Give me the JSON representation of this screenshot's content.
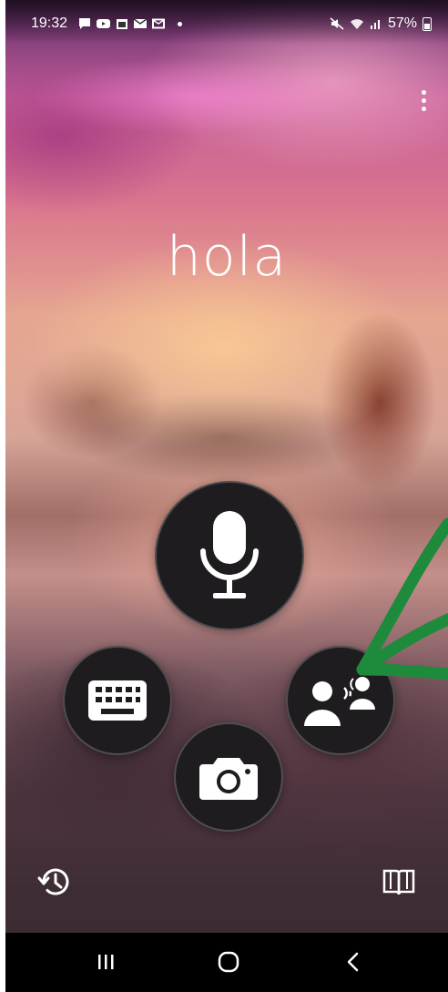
{
  "status_bar": {
    "time": "19:32",
    "notification_icons": [
      "message-icon",
      "youtube-icon",
      "calendar-icon",
      "mail-icon",
      "mail-outline-icon"
    ],
    "battery_percent": "57%",
    "system_icons": [
      "mute-icon",
      "wifi-icon",
      "signal-icon",
      "battery-icon"
    ]
  },
  "translator": {
    "phrase": "hola",
    "menu_icon": "more-vert-icon",
    "buttons": {
      "mic": "microphone-icon",
      "keyboard": "keyboard-icon",
      "camera": "camera-icon",
      "conversation": "conversation-icon",
      "history": "history-icon",
      "phrasebook": "phrasebook-icon"
    }
  },
  "annotation": {
    "color": "#1e8a3c",
    "shape": "arrow"
  },
  "navigation": {
    "items": [
      "recents-icon",
      "home-icon",
      "back-icon"
    ]
  }
}
